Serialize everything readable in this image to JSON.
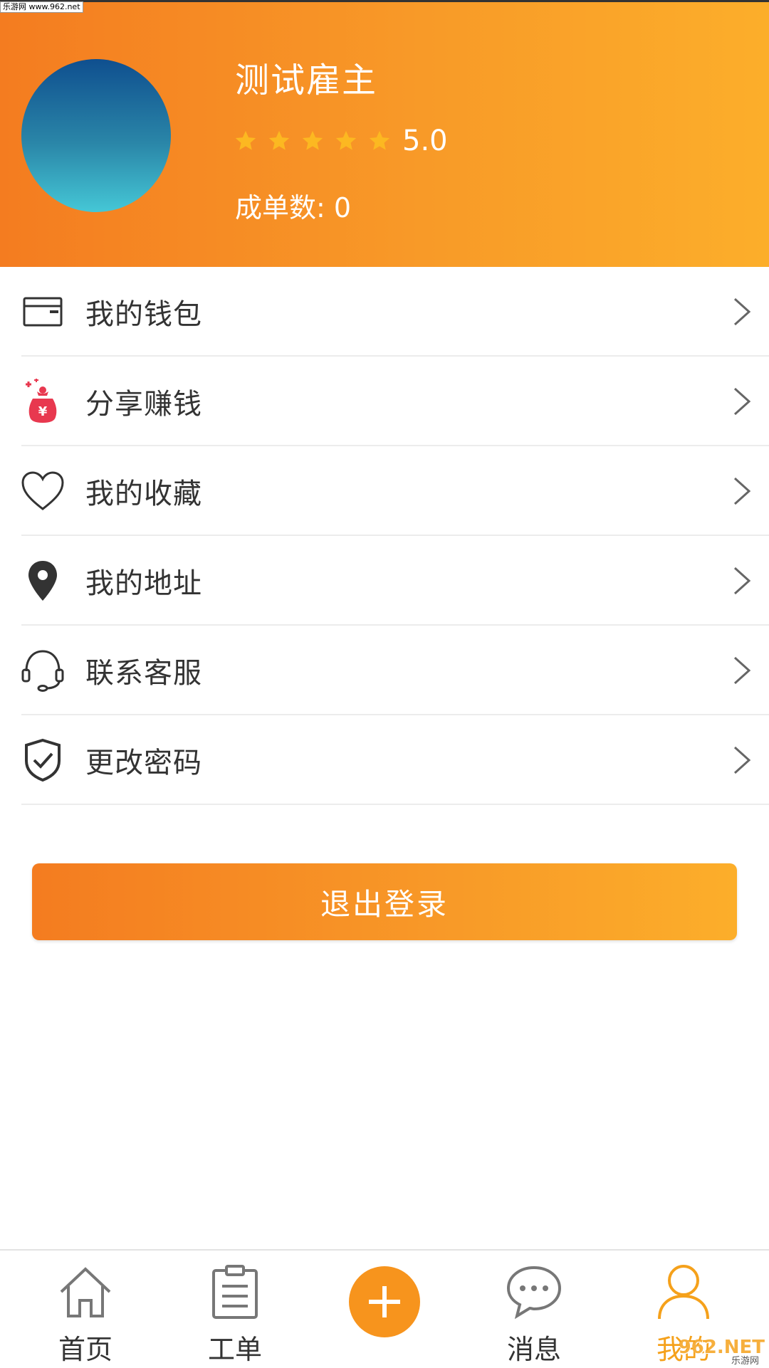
{
  "watermark": {
    "top_left": "乐游网 www.962.net",
    "corner_brand": "962.NET",
    "corner_sub": "乐游网"
  },
  "profile": {
    "name": "测试雇主",
    "rating": "5.0",
    "rating_stars": 5,
    "orders_label": "成单数:  0"
  },
  "menu": [
    {
      "label": "我的钱包",
      "icon": "wallet-icon"
    },
    {
      "label": "分享赚钱",
      "icon": "money-bag-icon"
    },
    {
      "label": "我的收藏",
      "icon": "heart-icon"
    },
    {
      "label": "我的地址",
      "icon": "location-pin-icon"
    },
    {
      "label": "联系客服",
      "icon": "headset-icon"
    },
    {
      "label": "更改密码",
      "icon": "shield-check-icon"
    }
  ],
  "logout_label": "退出登录",
  "nav": [
    {
      "label": "首页",
      "icon": "home-icon"
    },
    {
      "label": "工单",
      "icon": "clipboard-icon"
    },
    {
      "label": "",
      "icon": "plus-icon"
    },
    {
      "label": "消息",
      "icon": "chat-bubble-icon"
    },
    {
      "label": "我的",
      "icon": "person-icon",
      "active": true
    }
  ],
  "colors": {
    "accent": "#f7941d",
    "header_start": "#f47c20",
    "header_end": "#fcae2a",
    "star": "#fcb821",
    "text_dark": "#333333"
  }
}
